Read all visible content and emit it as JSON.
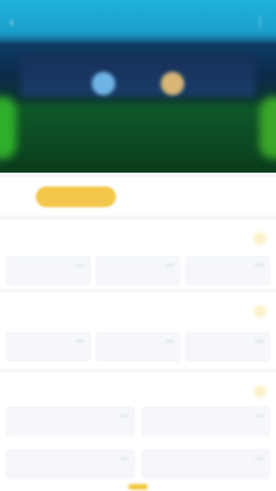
{
  "header": {
    "title": "",
    "back_icon": "back-arrow-icon",
    "more_icon": "more-icon",
    "home_team": "",
    "away_team": "",
    "match_time": ""
  },
  "tabs": [
    {
      "label": "",
      "active": true
    },
    {
      "label": "",
      "active": false
    },
    {
      "label": "",
      "active": false
    },
    {
      "label": "",
      "active": false
    }
  ],
  "markets": [
    {
      "title": "",
      "options": [
        {
          "label": "",
          "odds": ""
        },
        {
          "label": "",
          "odds": ""
        },
        {
          "label": "",
          "odds": ""
        }
      ]
    },
    {
      "title": "",
      "options": [
        {
          "label": "",
          "odds": ""
        },
        {
          "label": "",
          "odds": ""
        },
        {
          "label": "",
          "odds": ""
        }
      ]
    },
    {
      "title": "",
      "rows": [
        [
          {
            "label": "",
            "odds": ""
          },
          {
            "label": "",
            "odds": ""
          }
        ],
        [
          {
            "label": "",
            "odds": ""
          },
          {
            "label": "",
            "odds": ""
          }
        ]
      ]
    }
  ],
  "colors": {
    "header_top": "#1eb3d8",
    "active_tab": "#f3c84a",
    "indicator": "#f0c437"
  }
}
